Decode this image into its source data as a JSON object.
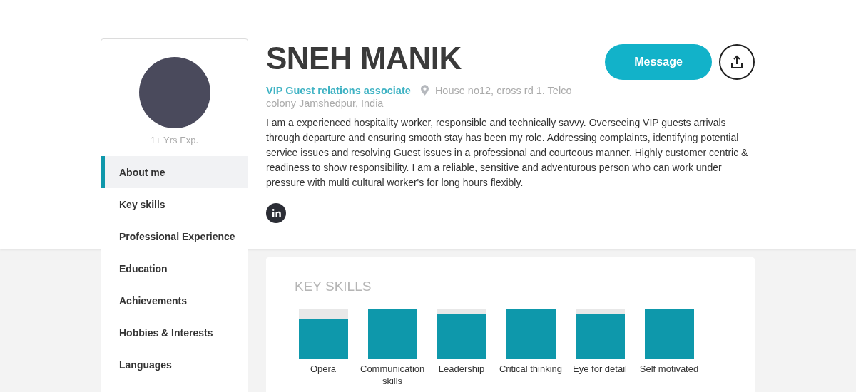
{
  "profile": {
    "experience": "1+ Yrs Exp.",
    "name": "SNEH MANIK",
    "title": "VIP Guest relations associate",
    "address_lines": [
      "House no12, cross rd 1. Telco",
      "colony Jamshedpur, India"
    ],
    "about": "I am a experienced hospitality worker, responsible and technically savvy. Overseeing VIP guests arrivals through departure and ensuring smooth stay has been my role. Addressing complaints, identifying potential service issues and resolving Guest issues in a professional and courteous manner. Highly customer centric & readiness to show responsibility. I am a reliable, sensitive and adventurous person who can work under pressure with multi cultural worker's for long hours flexibly."
  },
  "actions": {
    "message_button": "Message"
  },
  "sidebar": {
    "items": [
      {
        "label": "About me",
        "selected": true
      },
      {
        "label": "Key skills",
        "selected": false
      },
      {
        "label": "Professional Experience",
        "selected": false
      },
      {
        "label": "Education",
        "selected": false
      },
      {
        "label": "Achievements",
        "selected": false
      },
      {
        "label": "Hobbies & Interests",
        "selected": false
      },
      {
        "label": "Languages",
        "selected": false
      }
    ]
  },
  "key_skills": {
    "heading": "KEY SKILLS",
    "skills": [
      {
        "name": "Opera",
        "level": 0.8
      },
      {
        "name": "Communication skills",
        "level": 1
      },
      {
        "name": "Leadership",
        "level": 0.9
      },
      {
        "name": "Critical thinking",
        "level": 1
      },
      {
        "name": "Eye for detail",
        "level": 0.9
      },
      {
        "name": "Self motivated",
        "level": 1
      }
    ]
  }
}
